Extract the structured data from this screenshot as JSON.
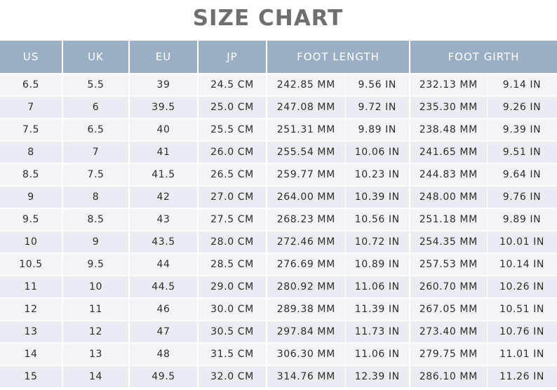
{
  "title": "SIZE CHART",
  "headers": {
    "us": "US",
    "uk": "UK",
    "eu": "EU",
    "jp": "JP",
    "foot_length": "FOOT LENGTH",
    "foot_girth": "FOOT GIRTH"
  },
  "rows": [
    {
      "us": "6.5",
      "uk": "5.5",
      "eu": "39",
      "jp": "24.5 CM",
      "len_mm": "242.85 MM",
      "len_in": "9.56 IN",
      "girth_mm": "232.13 MM",
      "girth_in": "9.14 IN"
    },
    {
      "us": "7",
      "uk": "6",
      "eu": "39.5",
      "jp": "25.0 CM",
      "len_mm": "247.08 MM",
      "len_in": "9.72 IN",
      "girth_mm": "235.30 MM",
      "girth_in": "9.26 IN"
    },
    {
      "us": "7.5",
      "uk": "6.5",
      "eu": "40",
      "jp": "25.5 CM",
      "len_mm": "251.31 MM",
      "len_in": "9.89 IN",
      "girth_mm": "238.48 MM",
      "girth_in": "9.39 IN"
    },
    {
      "us": "8",
      "uk": "7",
      "eu": "41",
      "jp": "26.0 CM",
      "len_mm": "255.54 MM",
      "len_in": "10.06 IN",
      "girth_mm": "241.65 MM",
      "girth_in": "9.51 IN"
    },
    {
      "us": "8.5",
      "uk": "7.5",
      "eu": "41.5",
      "jp": "26.5 CM",
      "len_mm": "259.77 MM",
      "len_in": "10.23 IN",
      "girth_mm": "244.83 MM",
      "girth_in": "9.64 IN"
    },
    {
      "us": "9",
      "uk": "8",
      "eu": "42",
      "jp": "27.0 CM",
      "len_mm": "264.00 MM",
      "len_in": "10.39 IN",
      "girth_mm": "248.00 MM",
      "girth_in": "9.76 IN"
    },
    {
      "us": "9.5",
      "uk": "8.5",
      "eu": "43",
      "jp": "27.5 CM",
      "len_mm": "268.23 MM",
      "len_in": "10.56 IN",
      "girth_mm": "251.18 MM",
      "girth_in": "9.89 IN"
    },
    {
      "us": "10",
      "uk": "9",
      "eu": "43.5",
      "jp": "28.0 CM",
      "len_mm": "272.46 MM",
      "len_in": "10.72 IN",
      "girth_mm": "254.35 MM",
      "girth_in": "10.01 IN"
    },
    {
      "us": "10.5",
      "uk": "9.5",
      "eu": "44",
      "jp": "28.5 CM",
      "len_mm": "276.69 MM",
      "len_in": "10.89 IN",
      "girth_mm": "257.53 MM",
      "girth_in": "10.14 IN"
    },
    {
      "us": "11",
      "uk": "10",
      "eu": "44.5",
      "jp": "29.0 CM",
      "len_mm": "280.92 MM",
      "len_in": "11.06 IN",
      "girth_mm": "260.70 MM",
      "girth_in": "10.26 IN"
    },
    {
      "us": "12",
      "uk": "11",
      "eu": "46",
      "jp": "30.0 CM",
      "len_mm": "289.38 MM",
      "len_in": "11.39 IN",
      "girth_mm": "267.05 MM",
      "girth_in": "10.51 IN"
    },
    {
      "us": "13",
      "uk": "12",
      "eu": "47",
      "jp": "30.5 CM",
      "len_mm": "297.84 MM",
      "len_in": "11.73 IN",
      "girth_mm": "273.40 MM",
      "girth_in": "10.76 IN"
    },
    {
      "us": "14",
      "uk": "13",
      "eu": "48",
      "jp": "31.5 CM",
      "len_mm": "306.30 MM",
      "len_in": "11.06 IN",
      "girth_mm": "279.75 MM",
      "girth_in": "11.01 IN"
    },
    {
      "us": "15",
      "uk": "14",
      "eu": "49.5",
      "jp": "32.0 CM",
      "len_mm": "314.76 MM",
      "len_in": "12.39 IN",
      "girth_mm": "286.10 MM",
      "girth_in": "11.26 IN"
    }
  ]
}
